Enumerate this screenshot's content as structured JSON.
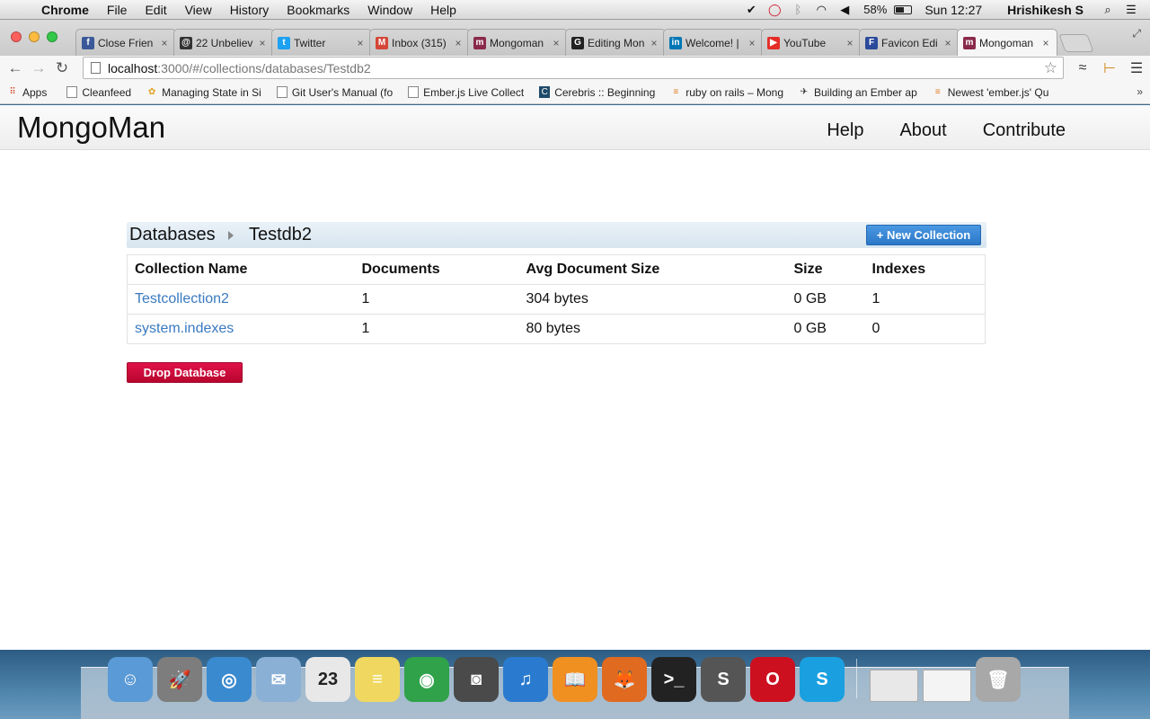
{
  "menubar": {
    "app_name": "Chrome",
    "menus": [
      "File",
      "Edit",
      "View",
      "History",
      "Bookmarks",
      "Window",
      "Help"
    ],
    "battery": "58%",
    "battery_level": 0.58,
    "clock": "Sun 12:27",
    "user": "Hrishikesh S"
  },
  "tabs": [
    {
      "label": "Close Frien",
      "fav": "f",
      "color": "#3b5998"
    },
    {
      "label": "22 Unbeliev",
      "fav": "@",
      "color": "#333333"
    },
    {
      "label": "Twitter",
      "fav": "t",
      "color": "#1da1f2"
    },
    {
      "label": "Inbox (315)",
      "fav": "M",
      "color": "#d44638"
    },
    {
      "label": "Mongoman",
      "fav": "m",
      "color": "#8a2a4a"
    },
    {
      "label": "Editing Mon",
      "fav": "G",
      "color": "#222222"
    },
    {
      "label": "Welcome! |",
      "fav": "in",
      "color": "#0077b5"
    },
    {
      "label": "YouTube",
      "fav": "▶",
      "color": "#e52d27"
    },
    {
      "label": "Favicon Edi",
      "fav": "F",
      "color": "#2b4a9a"
    },
    {
      "label": "Mongoman",
      "fav": "m",
      "color": "#8a2a4a",
      "active": true
    }
  ],
  "address": {
    "host": "localhost",
    "path": ":3000/#/collections/databases/Testdb2"
  },
  "bookmarks": [
    {
      "label": "Apps",
      "icon": "apps"
    },
    {
      "label": "Cleanfeed",
      "icon": "doc"
    },
    {
      "label": "Managing State in Si",
      "icon": "color"
    },
    {
      "label": "Git User's Manual (fo",
      "icon": "doc"
    },
    {
      "label": "Ember.js Live Collect",
      "icon": "doc"
    },
    {
      "label": "Cerebris :: Beginning",
      "icon": "C"
    },
    {
      "label": "ruby on rails – Mong",
      "icon": "stack"
    },
    {
      "label": "Building an Ember ap",
      "icon": "bird"
    },
    {
      "label": "Newest 'ember.js' Qu",
      "icon": "stack"
    }
  ],
  "app": {
    "brand": "MongoMan",
    "nav": [
      "Help",
      "About",
      "Contribute"
    ]
  },
  "breadcrumb": {
    "root": "Databases",
    "current": "Testdb2"
  },
  "buttons": {
    "new_collection": "+ New Collection",
    "drop_database": "Drop Database"
  },
  "table": {
    "headers": [
      "Collection Name",
      "Documents",
      "Avg Document Size",
      "Size",
      "Indexes"
    ],
    "rows": [
      [
        "Testcollection2",
        "1",
        "304 bytes",
        "0 GB",
        "1"
      ],
      [
        "system.indexes",
        "1",
        "80 bytes",
        "0 GB",
        "0"
      ]
    ]
  },
  "dock": [
    {
      "name": "finder-icon",
      "glyph": "☺",
      "color": "#5a9ad6"
    },
    {
      "name": "launchpad-icon",
      "glyph": "🚀",
      "color": "#7d7d7d"
    },
    {
      "name": "safari-icon",
      "glyph": "◎",
      "color": "#3a8ad0"
    },
    {
      "name": "mail-icon",
      "glyph": "✉",
      "color": "#8ab0d6"
    },
    {
      "name": "calendar-icon",
      "glyph": "23",
      "color": "#e8e8e8"
    },
    {
      "name": "notes-icon",
      "glyph": "≡",
      "color": "#f0d860"
    },
    {
      "name": "chrome-icon",
      "glyph": "◉",
      "color": "#2fa24a"
    },
    {
      "name": "facetime-icon",
      "glyph": "◙",
      "color": "#4a4a4a"
    },
    {
      "name": "itunes-icon",
      "glyph": "♫",
      "color": "#2a7ad0"
    },
    {
      "name": "ibooks-icon",
      "glyph": "📖",
      "color": "#f09020"
    },
    {
      "name": "firefox-icon",
      "glyph": "🦊",
      "color": "#e06a20"
    },
    {
      "name": "terminal-icon",
      "glyph": ">_",
      "color": "#222222"
    },
    {
      "name": "sublime-icon",
      "glyph": "S",
      "color": "#555555"
    },
    {
      "name": "opera-icon",
      "glyph": "O",
      "color": "#cc1020"
    },
    {
      "name": "skype-icon",
      "glyph": "S",
      "color": "#1aa0e0"
    },
    {
      "name": "window-thumb-1-icon",
      "glyph": "",
      "color": "#e8e8e8"
    },
    {
      "name": "window-thumb-2-icon",
      "glyph": "",
      "color": "#f4f4f4"
    },
    {
      "name": "trash-icon",
      "glyph": "🗑",
      "color": "#a8a8a8"
    }
  ]
}
